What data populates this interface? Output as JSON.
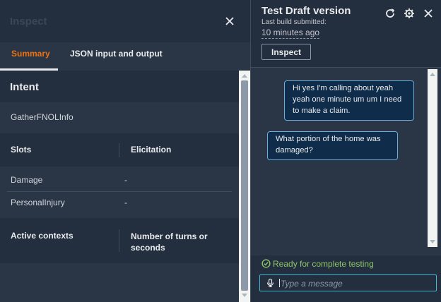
{
  "inspect_panel": {
    "title": "Inspect",
    "tabs": [
      {
        "label": "Summary",
        "active": true
      },
      {
        "label": "JSON input and output",
        "active": false
      }
    ],
    "intent": {
      "heading": "Intent",
      "value": "GatherFNOLInfo"
    },
    "slots": {
      "columns": [
        "Slots",
        "Elicitation"
      ],
      "rows": [
        {
          "name": "Damage",
          "elicitation": "-"
        },
        {
          "name": "PersonalInjury",
          "elicitation": "-"
        }
      ]
    },
    "active_contexts": {
      "columns": [
        "Active contexts",
        "Number of turns or seconds"
      ]
    }
  },
  "test_panel": {
    "title": "Test Draft version",
    "last_build_label": "Last build submitted:",
    "last_build_time": "10 minutes ago",
    "inspect_button": "Inspect",
    "messages": [
      {
        "from": "user",
        "text": "Hi yes I'm calling about yeah yeah one minute um um I need to make a claim."
      },
      {
        "from": "bot",
        "text": "What portion of the home was damaged?"
      }
    ],
    "status": "Ready for complete testing",
    "input_placeholder": "Type a message"
  },
  "colors": {
    "accent_tab": "#ec7211",
    "status_green": "#8fc46b",
    "bubble_border": "#6aaedb",
    "input_border": "#44b9d6"
  }
}
